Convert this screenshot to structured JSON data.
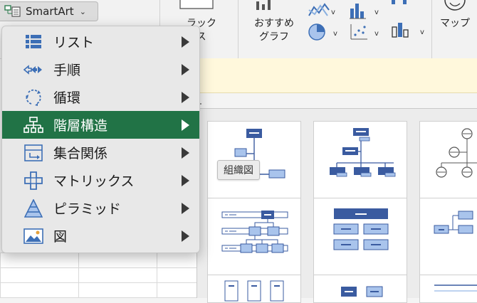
{
  "ribbon": {
    "smartart_label": "SmartArt",
    "group1_line1": "ラック",
    "group1_line2": "クス",
    "recommended_line1": "おすすめ",
    "recommended_line2": "グラフ",
    "map_label": "マップ"
  },
  "sheet": {
    "row_text": "す"
  },
  "menu": {
    "items": [
      {
        "label": "リスト",
        "icon": "list-icon"
      },
      {
        "label": "手順",
        "icon": "process-icon"
      },
      {
        "label": "循環",
        "icon": "cycle-icon"
      },
      {
        "label": "階層構造",
        "icon": "hierarchy-icon",
        "selected": true
      },
      {
        "label": "集合関係",
        "icon": "relationship-icon"
      },
      {
        "label": "マトリックス",
        "icon": "matrix-icon"
      },
      {
        "label": "ピラミッド",
        "icon": "pyramid-icon"
      },
      {
        "label": "図",
        "icon": "picture-icon"
      }
    ]
  },
  "tooltip": "組織図",
  "colors": {
    "selected": "#217346",
    "smartart_blue": "#3a5ba0",
    "smartart_light": "#a9c4ec"
  }
}
